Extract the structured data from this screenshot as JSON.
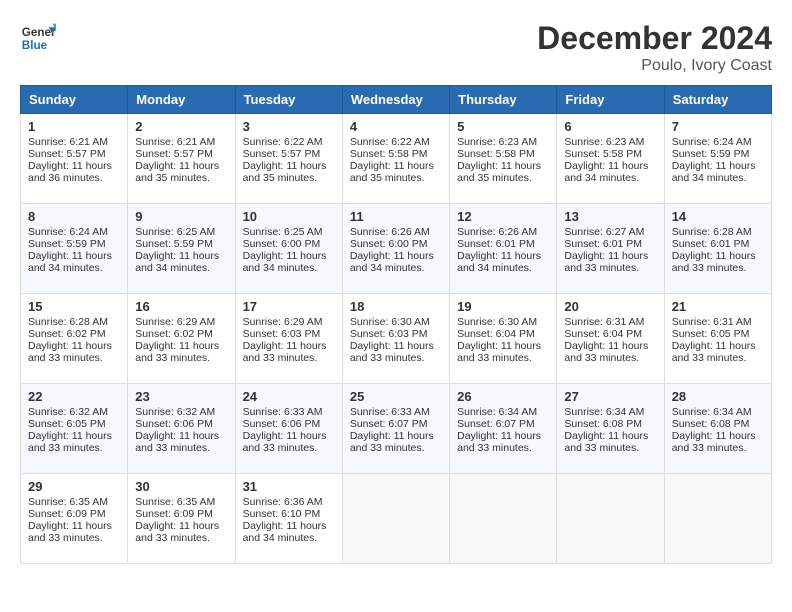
{
  "header": {
    "logo_line1": "General",
    "logo_line2": "Blue",
    "month": "December 2024",
    "location": "Poulo, Ivory Coast"
  },
  "weekdays": [
    "Sunday",
    "Monday",
    "Tuesday",
    "Wednesday",
    "Thursday",
    "Friday",
    "Saturday"
  ],
  "weeks": [
    [
      {
        "day": "1",
        "info": "Sunrise: 6:21 AM\nSunset: 5:57 PM\nDaylight: 11 hours\nand 36 minutes."
      },
      {
        "day": "2",
        "info": "Sunrise: 6:21 AM\nSunset: 5:57 PM\nDaylight: 11 hours\nand 35 minutes."
      },
      {
        "day": "3",
        "info": "Sunrise: 6:22 AM\nSunset: 5:57 PM\nDaylight: 11 hours\nand 35 minutes."
      },
      {
        "day": "4",
        "info": "Sunrise: 6:22 AM\nSunset: 5:58 PM\nDaylight: 11 hours\nand 35 minutes."
      },
      {
        "day": "5",
        "info": "Sunrise: 6:23 AM\nSunset: 5:58 PM\nDaylight: 11 hours\nand 35 minutes."
      },
      {
        "day": "6",
        "info": "Sunrise: 6:23 AM\nSunset: 5:58 PM\nDaylight: 11 hours\nand 34 minutes."
      },
      {
        "day": "7",
        "info": "Sunrise: 6:24 AM\nSunset: 5:59 PM\nDaylight: 11 hours\nand 34 minutes."
      }
    ],
    [
      {
        "day": "8",
        "info": "Sunrise: 6:24 AM\nSunset: 5:59 PM\nDaylight: 11 hours\nand 34 minutes."
      },
      {
        "day": "9",
        "info": "Sunrise: 6:25 AM\nSunset: 5:59 PM\nDaylight: 11 hours\nand 34 minutes."
      },
      {
        "day": "10",
        "info": "Sunrise: 6:25 AM\nSunset: 6:00 PM\nDaylight: 11 hours\nand 34 minutes."
      },
      {
        "day": "11",
        "info": "Sunrise: 6:26 AM\nSunset: 6:00 PM\nDaylight: 11 hours\nand 34 minutes."
      },
      {
        "day": "12",
        "info": "Sunrise: 6:26 AM\nSunset: 6:01 PM\nDaylight: 11 hours\nand 34 minutes."
      },
      {
        "day": "13",
        "info": "Sunrise: 6:27 AM\nSunset: 6:01 PM\nDaylight: 11 hours\nand 33 minutes."
      },
      {
        "day": "14",
        "info": "Sunrise: 6:28 AM\nSunset: 6:01 PM\nDaylight: 11 hours\nand 33 minutes."
      }
    ],
    [
      {
        "day": "15",
        "info": "Sunrise: 6:28 AM\nSunset: 6:02 PM\nDaylight: 11 hours\nand 33 minutes."
      },
      {
        "day": "16",
        "info": "Sunrise: 6:29 AM\nSunset: 6:02 PM\nDaylight: 11 hours\nand 33 minutes."
      },
      {
        "day": "17",
        "info": "Sunrise: 6:29 AM\nSunset: 6:03 PM\nDaylight: 11 hours\nand 33 minutes."
      },
      {
        "day": "18",
        "info": "Sunrise: 6:30 AM\nSunset: 6:03 PM\nDaylight: 11 hours\nand 33 minutes."
      },
      {
        "day": "19",
        "info": "Sunrise: 6:30 AM\nSunset: 6:04 PM\nDaylight: 11 hours\nand 33 minutes."
      },
      {
        "day": "20",
        "info": "Sunrise: 6:31 AM\nSunset: 6:04 PM\nDaylight: 11 hours\nand 33 minutes."
      },
      {
        "day": "21",
        "info": "Sunrise: 6:31 AM\nSunset: 6:05 PM\nDaylight: 11 hours\nand 33 minutes."
      }
    ],
    [
      {
        "day": "22",
        "info": "Sunrise: 6:32 AM\nSunset: 6:05 PM\nDaylight: 11 hours\nand 33 minutes."
      },
      {
        "day": "23",
        "info": "Sunrise: 6:32 AM\nSunset: 6:06 PM\nDaylight: 11 hours\nand 33 minutes."
      },
      {
        "day": "24",
        "info": "Sunrise: 6:33 AM\nSunset: 6:06 PM\nDaylight: 11 hours\nand 33 minutes."
      },
      {
        "day": "25",
        "info": "Sunrise: 6:33 AM\nSunset: 6:07 PM\nDaylight: 11 hours\nand 33 minutes."
      },
      {
        "day": "26",
        "info": "Sunrise: 6:34 AM\nSunset: 6:07 PM\nDaylight: 11 hours\nand 33 minutes."
      },
      {
        "day": "27",
        "info": "Sunrise: 6:34 AM\nSunset: 6:08 PM\nDaylight: 11 hours\nand 33 minutes."
      },
      {
        "day": "28",
        "info": "Sunrise: 6:34 AM\nSunset: 6:08 PM\nDaylight: 11 hours\nand 33 minutes."
      }
    ],
    [
      {
        "day": "29",
        "info": "Sunrise: 6:35 AM\nSunset: 6:09 PM\nDaylight: 11 hours\nand 33 minutes."
      },
      {
        "day": "30",
        "info": "Sunrise: 6:35 AM\nSunset: 6:09 PM\nDaylight: 11 hours\nand 33 minutes."
      },
      {
        "day": "31",
        "info": "Sunrise: 6:36 AM\nSunset: 6:10 PM\nDaylight: 11 hours\nand 34 minutes."
      },
      {
        "day": "",
        "info": ""
      },
      {
        "day": "",
        "info": ""
      },
      {
        "day": "",
        "info": ""
      },
      {
        "day": "",
        "info": ""
      }
    ]
  ]
}
